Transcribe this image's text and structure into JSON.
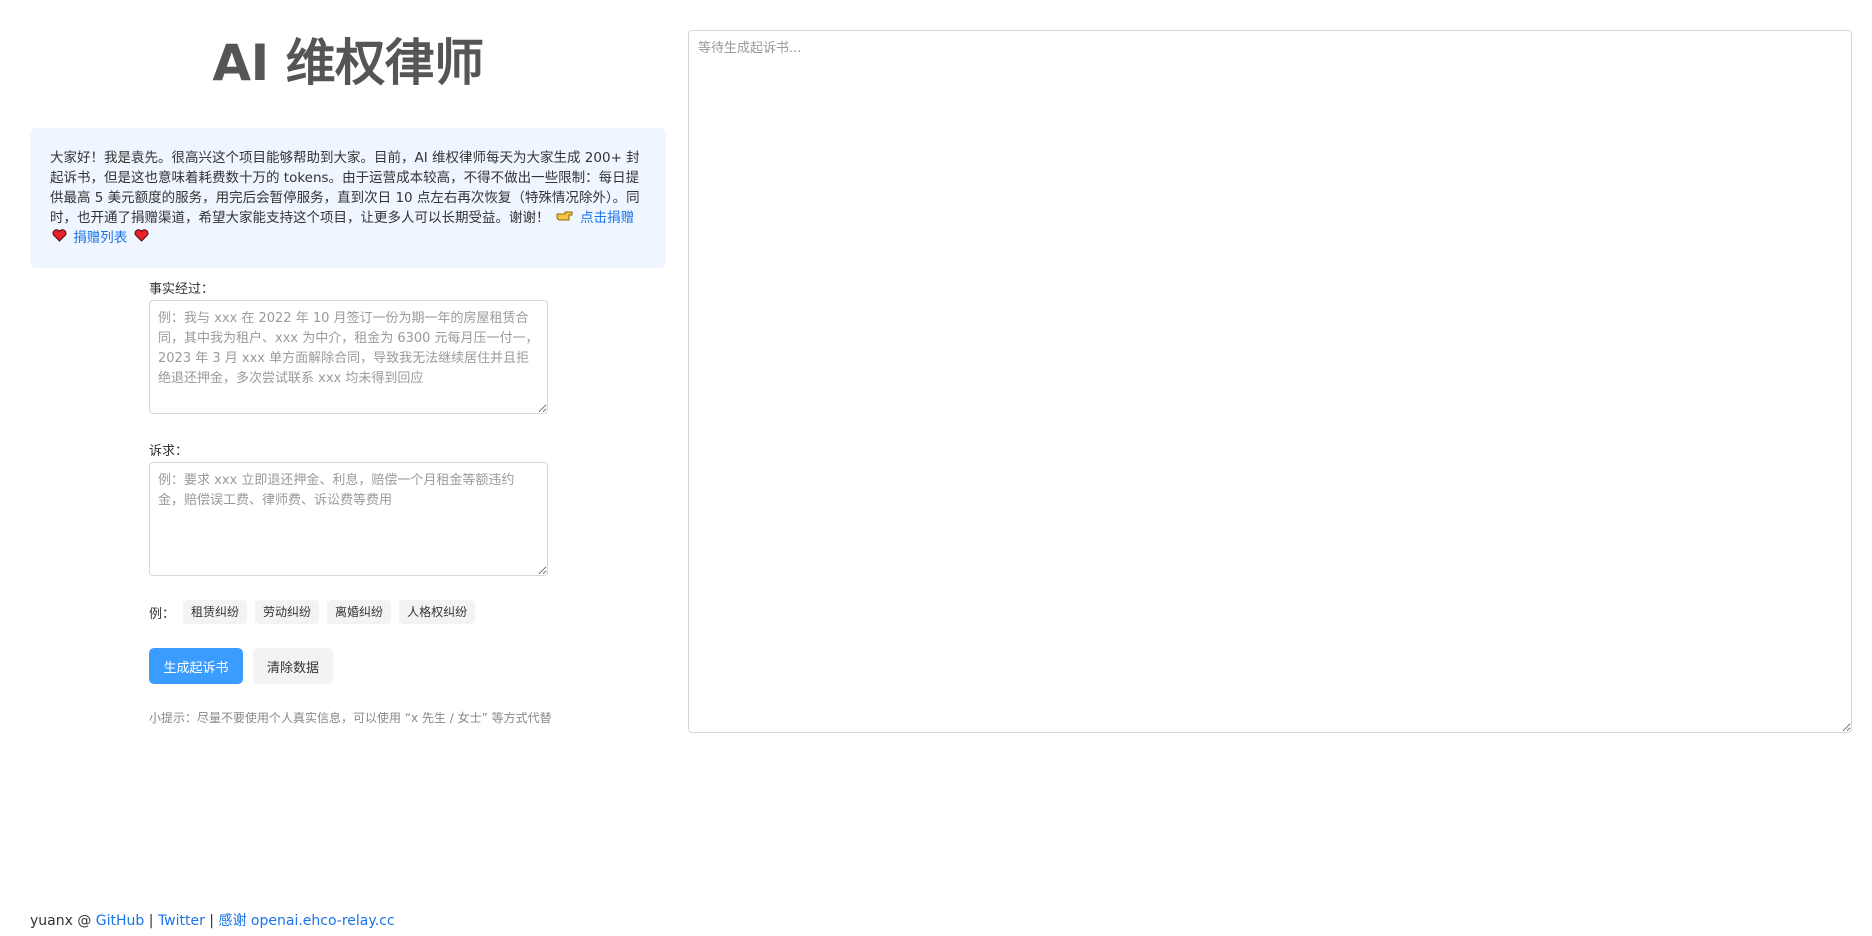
{
  "app": {
    "title": "AI 维权律师"
  },
  "notice": {
    "text": "大家好！我是袁先。很高兴这个项目能够帮助到大家。目前，AI 维权律师每天为大家生成 200+ 封起诉书，但是这也意味着耗费数十万的 tokens。由于运营成本较高，不得不做出一些限制：每日提供最高 5 美元额度的服务，用完后会暂停服务，直到次日 10 点左右再次恢复（特殊情况除外）。同时，也开通了捐赠渠道，希望大家能支持这个项目，让更多人可以长期受益。谢谢！",
    "donate_link": "点击捐赠",
    "donation_list_link": "捐赠列表",
    "icons": [
      "pointing-hand-icon",
      "heart-icon"
    ],
    "heart_color": "#e8232c"
  },
  "form": {
    "facts_label": "事实经过：",
    "facts_placeholder": "例：我与 xxx 在 2022 年 10 月签订一份为期一年的房屋租赁合同，其中我为租户、xxx 为中介，租金为 6300 元每月压一付一，2023 年 3 月 xxx 单方面解除合同，导致我无法继续居住并且拒绝退还押金，多次尝试联系 xxx 均未得到回应",
    "claims_label": "诉求：",
    "claims_placeholder": "例：要求 xxx 立即退还押金、利息，赔偿一个月租金等额违约金，赔偿误工费、律师费、诉讼费等费用",
    "examples_label": "例：",
    "examples": [
      "租赁纠纷",
      "劳动纠纷",
      "离婚纠纷",
      "人格权纠纷"
    ],
    "generate_button": "生成起诉书",
    "clear_button": "清除数据",
    "hint": "小提示：尽量不要使用个人真实信息，可以使用 “x 先生 / 女士” 等方式代替"
  },
  "output": {
    "placeholder": "等待生成起诉书..."
  },
  "footer": {
    "author": "yuanx @ ",
    "github": "GitHub",
    "sep1": " | ",
    "twitter": "Twitter",
    "sep2": " | ",
    "thanks": "感谢 openai.ehco-relay.cc"
  },
  "colors": {
    "accent": "#3b9cff",
    "link": "#1a73e8",
    "notice_bg": "#eff6ff"
  }
}
